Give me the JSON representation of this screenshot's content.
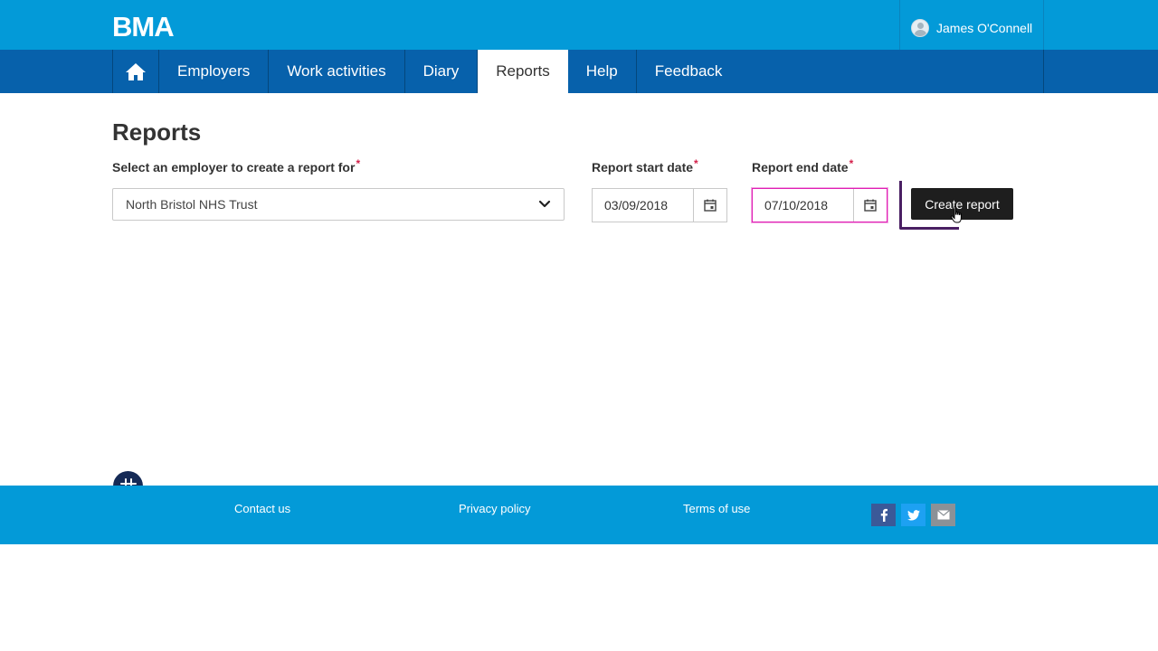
{
  "header": {
    "logo": "BMA",
    "user_name": "James O'Connell"
  },
  "nav": {
    "items": [
      {
        "label": "Employers"
      },
      {
        "label": "Work activities"
      },
      {
        "label": "Diary"
      },
      {
        "label": "Reports",
        "active": true
      },
      {
        "label": "Help"
      },
      {
        "label": "Feedback"
      }
    ]
  },
  "main": {
    "title": "Reports",
    "employer_label": "Select an employer to create a report for",
    "employer_value": "North Bristol NHS Trust",
    "start_label": "Report start date",
    "start_value": "03/09/2018",
    "end_label": "Report end date",
    "end_value": "07/10/2018",
    "required_mark": "*",
    "create_button": "Create report"
  },
  "footer": {
    "links": [
      "Contact us",
      "Privacy policy",
      "Terms of use"
    ]
  },
  "colors": {
    "header_blue": "#039ad8",
    "nav_blue": "#0761ab",
    "required_red": "#d4214b",
    "focus_magenta": "#e01fb4"
  },
  "icons": [
    "home-icon",
    "chevron-down-icon",
    "calendar-icon",
    "facebook-icon",
    "twitter-icon",
    "email-icon",
    "avatar-icon",
    "badge-icon",
    "cursor-icon"
  ]
}
